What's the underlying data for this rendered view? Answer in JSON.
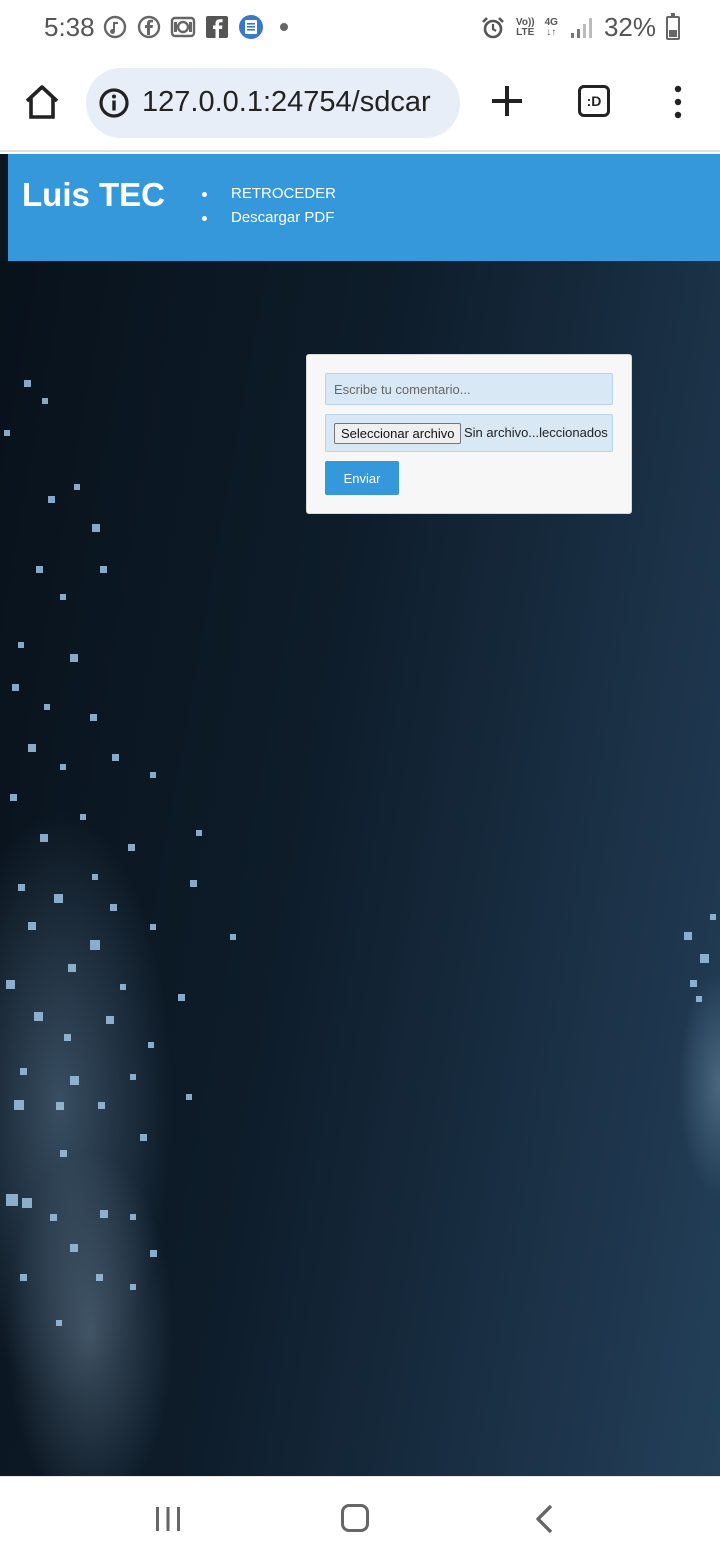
{
  "status_bar": {
    "time": "5:38",
    "volte_line1": "Vo))",
    "volte_line2": "LTE",
    "network_line1": "4G",
    "network_line2": "↓↑",
    "battery_percent": "32%",
    "battery_level": 0.32,
    "icons": [
      "music-app-icon",
      "facebook-messenger-icon",
      "camera-app-icon",
      "facebook-icon",
      "word-app-icon",
      "notification-dot",
      "alarm-icon",
      "volte-icon",
      "4g-icon",
      "signal-icon",
      "battery-icon"
    ]
  },
  "browser": {
    "url": "127.0.0.1:24754/sdcar",
    "tabs_label": ":D",
    "icons": [
      "home-icon",
      "info-icon",
      "plus-icon",
      "tabs-icon",
      "menu-icon"
    ]
  },
  "site": {
    "title": "Luis TEC",
    "nav": [
      {
        "label": "RETROCEDER"
      },
      {
        "label": "Descargar PDF"
      }
    ],
    "accent_color": "#3498db"
  },
  "comment_form": {
    "placeholder": "Escribe tu comentario...",
    "file_button_label": "Seleccionar archivo",
    "file_status": "Sin archivo...leccionados",
    "submit_label": "Enviar"
  },
  "system_nav": {
    "icons": [
      "recents-icon",
      "home-icon",
      "back-icon"
    ]
  }
}
